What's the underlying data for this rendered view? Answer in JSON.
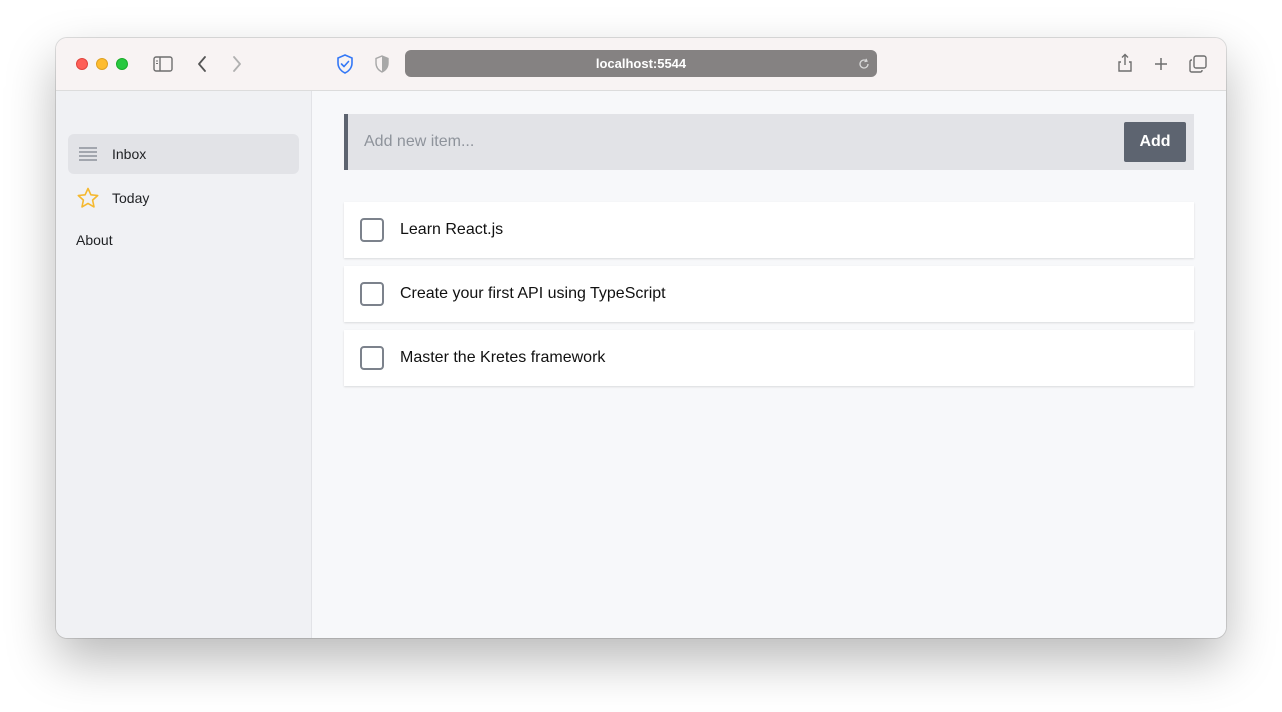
{
  "browser": {
    "url": "localhost:5544",
    "traffic_lights": [
      "close",
      "minimize",
      "zoom"
    ],
    "icons": [
      "sidebar-toggle-icon",
      "back-icon",
      "forward-icon",
      "shield-check-icon",
      "privacy-shield-icon",
      "reload-icon",
      "share-icon",
      "new-tab-icon",
      "tab-overview-icon"
    ]
  },
  "sidebar": {
    "items": [
      {
        "label": "Inbox",
        "icon": "list-icon",
        "active": true
      },
      {
        "label": "Today",
        "icon": "star-icon",
        "active": false
      }
    ],
    "about_label": "About"
  },
  "main": {
    "input_placeholder": "Add new item...",
    "add_label": "Add",
    "todos": [
      {
        "text": "Learn React.js",
        "done": false
      },
      {
        "text": "Create your first API using TypeScript",
        "done": false
      },
      {
        "text": "Master the Kretes framework",
        "done": false
      }
    ]
  },
  "colors": {
    "accent": "#5d6470",
    "star": "#f5b82e",
    "shield": "#3478f6"
  }
}
